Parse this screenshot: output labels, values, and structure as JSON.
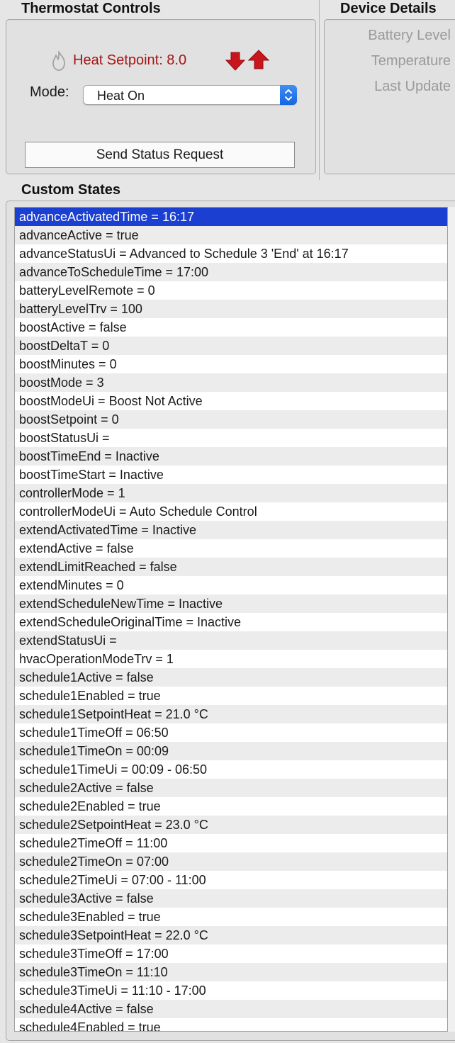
{
  "thermostat": {
    "section_title": "Thermostat Controls",
    "setpoint_label": "Heat Setpoint: 8.0",
    "mode_label": "Mode:",
    "mode_value": "Heat On",
    "send_button_label": "Send Status Request",
    "setpoint_color": "#a51515",
    "arrow_color": "#c8161c"
  },
  "device": {
    "section_title": "Device Details",
    "labels": [
      "Battery Level",
      "Temperature",
      "Last Update"
    ]
  },
  "states": {
    "section_title": "Custom States",
    "selected_index": 0,
    "selection_color": "#1a3fd1",
    "items": [
      "advanceActivatedTime = 16:17",
      "advanceActive = true",
      "advanceStatusUi = Advanced to Schedule 3 'End' at 16:17",
      "advanceToScheduleTime = 17:00",
      "batteryLevelRemote = 0",
      "batteryLevelTrv = 100",
      "boostActive = false",
      "boostDeltaT = 0",
      "boostMinutes = 0",
      "boostMode = 3",
      "boostModeUi = Boost Not Active",
      "boostSetpoint = 0",
      "boostStatusUi =",
      "boostTimeEnd = Inactive",
      "boostTimeStart = Inactive",
      "controllerMode = 1",
      "controllerModeUi = Auto Schedule Control",
      "extendActivatedTime = Inactive",
      "extendActive = false",
      "extendLimitReached = false",
      "extendMinutes = 0",
      "extendScheduleNewTime = Inactive",
      "extendScheduleOriginalTime = Inactive",
      "extendStatusUi =",
      "hvacOperationModeTrv = 1",
      "schedule1Active = false",
      "schedule1Enabled = true",
      "schedule1SetpointHeat = 21.0 °C",
      "schedule1TimeOff = 06:50",
      "schedule1TimeOn = 00:09",
      "schedule1TimeUi = 00:09 - 06:50",
      "schedule2Active = false",
      "schedule2Enabled = true",
      "schedule2SetpointHeat = 23.0 °C",
      "schedule2TimeOff = 11:00",
      "schedule2TimeOn = 07:00",
      "schedule2TimeUi = 07:00 - 11:00",
      "schedule3Active = false",
      "schedule3Enabled = true",
      "schedule3SetpointHeat = 22.0 °C",
      "schedule3TimeOff = 17:00",
      "schedule3TimeOn = 11:10",
      "schedule3TimeUi = 11:10 - 17:00",
      "schedule4Active = false",
      "schedule4Enabled = true"
    ]
  }
}
